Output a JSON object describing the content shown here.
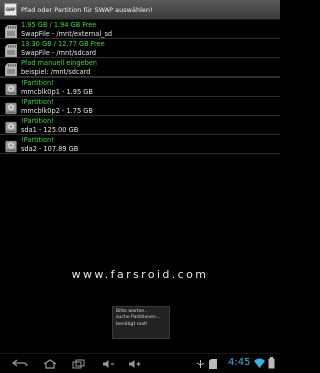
{
  "window": {
    "icon_text": "SWAP",
    "title": "Pfad oder Partition für SWAP auswählen!"
  },
  "items": [
    {
      "line1": "1.95 GB / 1.94 GB Free",
      "line2": "SwapFile - /mnt/external_sd",
      "icon": "sd-card-icon"
    },
    {
      "line1": "13.30 GB / 12.77 GB Free",
      "line2": "SwapFile - /mnt/sdcard",
      "icon": "sd-card-icon"
    },
    {
      "line1": "Pfad manuell eingeben",
      "line2": "beispiel: /mnt/sdcard",
      "icon": "sd-card-icon"
    },
    {
      "line1": "!Partition!",
      "line2": "mmcblk0p1 - 1.95 GB",
      "icon": "hard-drive-icon"
    },
    {
      "line1": "!Partition!",
      "line2": "mmcblk0p2 - 1.75 GB",
      "icon": "hard-drive-icon"
    },
    {
      "line1": "!Partition!",
      "line2": "sda1 - 125.00 GB",
      "icon": "hard-drive-icon"
    },
    {
      "line1": "!Partition!",
      "line2": "sda2 - 107.89 GB",
      "icon": "hard-drive-icon"
    }
  ],
  "watermark": "www.farsroid.com",
  "toast": {
    "line1": "Bitte warten..",
    "line2": "suche Partitionen...",
    "line3": "benötigt root!"
  },
  "status_bar": {
    "time": "4:45"
  },
  "colors": {
    "highlight_green": "#2ee02e",
    "clock_blue": "#33b5e5"
  }
}
